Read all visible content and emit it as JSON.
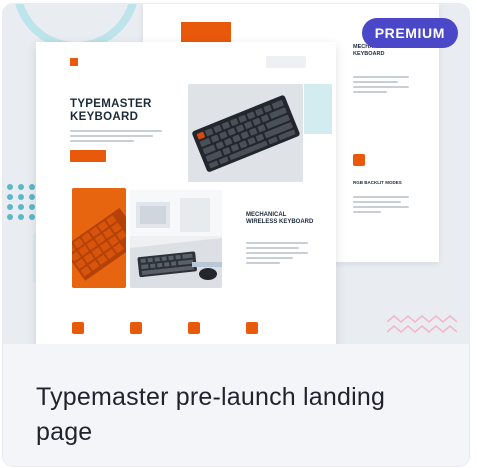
{
  "card": {
    "title": "Typemaster pre-launch landing page",
    "badge": "PREMIUM"
  },
  "preview": {
    "front_page": {
      "nav_button": "",
      "hero_title": "TYPEMASTER KEYBOARD",
      "cta_primary": "",
      "cta_secondary": "",
      "mid_title": "MECHANICAL WIRELESS KEYBOARD"
    },
    "back_page": {
      "title": "MECHANICAL WIRELESS KEYBOARD",
      "subtitle": "RGB BACKLIT MODES"
    }
  },
  "colors": {
    "accent": "#e8590c",
    "badge": "#4a47c8",
    "text_dark": "#1c2a3a",
    "teal": "#5bb8c9"
  },
  "icons": [
    "keyboard-photo",
    "desk-photo",
    "feature-icon"
  ]
}
